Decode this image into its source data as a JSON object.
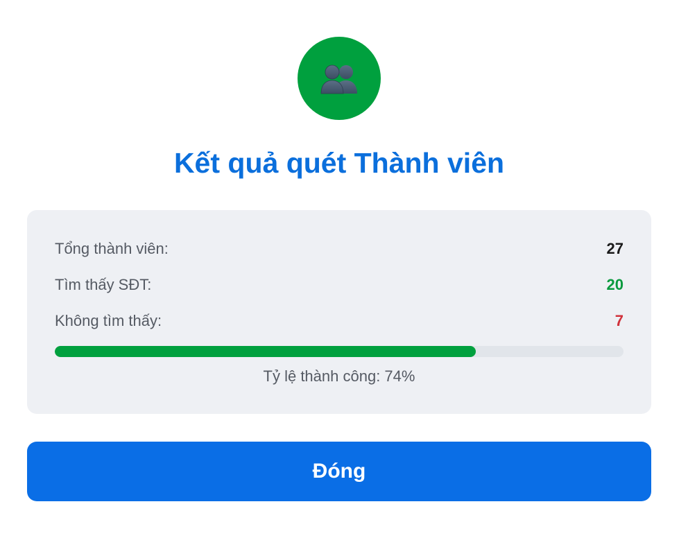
{
  "header": {
    "icon": "two-users-icon",
    "icon_bg_color": "#00a03e",
    "title": "Kết quả quét Thành viên",
    "title_color": "#0b6fdc"
  },
  "stats": {
    "total": {
      "label": "Tổng thành viên:",
      "value": "27",
      "color": "#1a1a1a"
    },
    "found": {
      "label": "Tìm thấy SĐT:",
      "value": "20",
      "color": "#0a9a3e"
    },
    "missing": {
      "label": "Không tìm thấy:",
      "value": "7",
      "color": "#d0313a"
    }
  },
  "progress": {
    "percent": 74,
    "fill_color": "#00a03e",
    "caption": "Tỷ lệ thành công: 74%"
  },
  "actions": {
    "close_label": "Đóng",
    "close_color": "#0a6ee6"
  }
}
